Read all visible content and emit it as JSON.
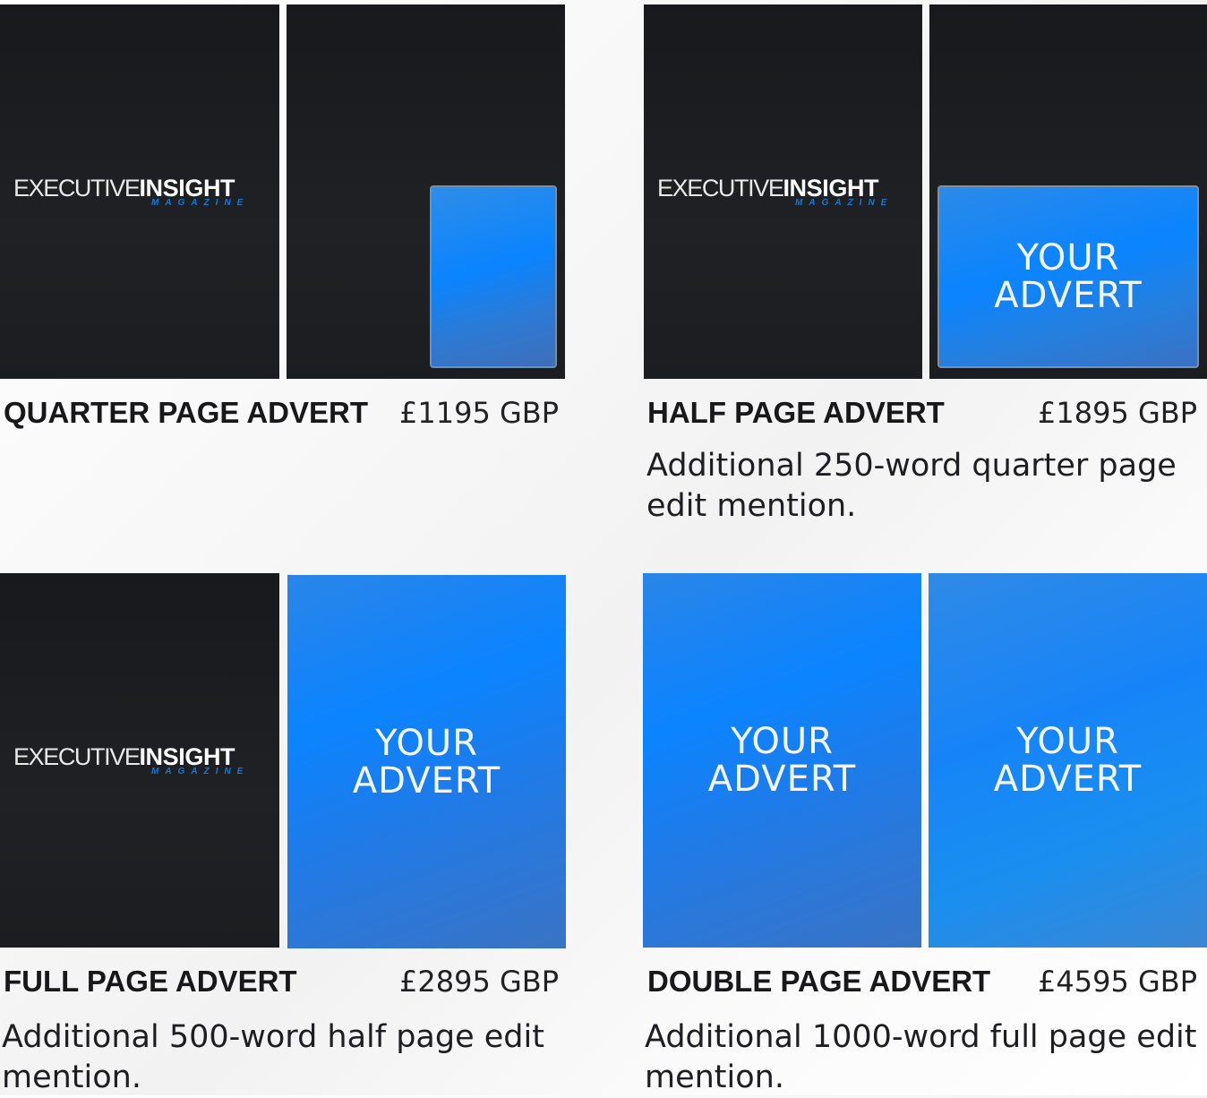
{
  "logo": {
    "word_light": "EXECUTIVE",
    "word_bold": "INSIGHT",
    "sub": "MAGAZINE"
  },
  "advert_placeholder": [
    "YOUR",
    "ADVERT"
  ],
  "packages": [
    {
      "title": "QUARTER PAGE ADVERT",
      "price": "£1195 GBP",
      "description": ""
    },
    {
      "title": "HALF PAGE ADVERT",
      "price": "£1895 GBP",
      "description": "Additional 250-word quarter page edit mention."
    },
    {
      "title": "FULL PAGE ADVERT",
      "price": "£2895 GBP",
      "description": "Additional 500-word half page edit mention."
    },
    {
      "title": "DOUBLE PAGE ADVERT",
      "price": "£4595 GBP",
      "description": "Additional 1000-word full page edit mention."
    }
  ],
  "colors": {
    "magazine_page": "#1c1e21",
    "advert_blue": "#0a84ff",
    "logo_accent": "#1478d8",
    "text_dark": "#18181b"
  }
}
